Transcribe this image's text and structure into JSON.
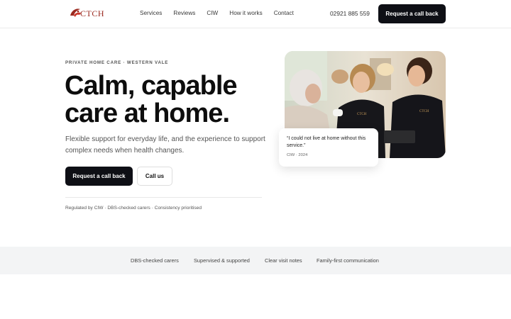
{
  "brand": {
    "logo_text": "CTCH",
    "accent": "#9b2a20"
  },
  "nav": {
    "items": [
      "Services",
      "Reviews",
      "CIW",
      "How it works",
      "Contact"
    ],
    "phone": "02921 885 559",
    "cta": "Request a call back"
  },
  "hero": {
    "eyebrow": "PRIVATE HOME CARE · WESTERN VALE",
    "headline_line1": "Calm, capable",
    "headline_line2": "care at home.",
    "subtitle": "Flexible support for everyday life, and the experience to support complex needs when health changes.",
    "primary_cta": "Request a call back",
    "secondary_cta": "Call us",
    "trust_line": "Regulated by CIW · DBS-checked carers · Consistency prioritised"
  },
  "testimonial": {
    "quote": "“I could not live at home without this service.”",
    "meta": "CIW · 2024"
  },
  "features": [
    "DBS-checked carers",
    "Supervised & supported",
    "Clear visit notes",
    "Family-first communication"
  ],
  "colors": {
    "dark_button": "#0e0f15",
    "feature_band": "#f3f4f5"
  }
}
